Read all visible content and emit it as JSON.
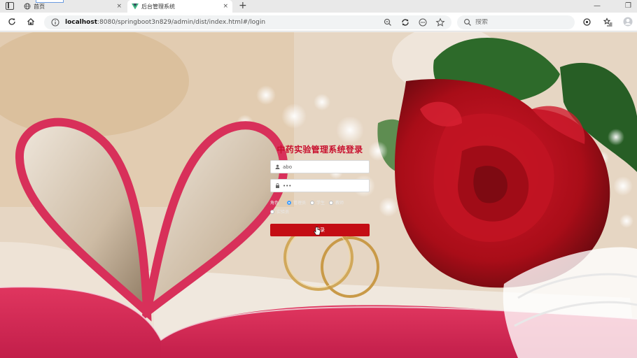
{
  "browser": {
    "tabs": [
      {
        "label": "首页",
        "close": "×"
      },
      {
        "label": "后台管理系统",
        "close": "×"
      }
    ],
    "new_tab": "+",
    "window_controls": {
      "minimize": "—",
      "restore": "❐"
    },
    "url_host": "localhost",
    "url_rest": ":8080/springboot3n829/admin/dist/index.html#/login",
    "search_placeholder": "搜索"
  },
  "login": {
    "title": "中药实验管理系统登录",
    "username_value": "abo",
    "password_value": "•••",
    "role_label": "角色",
    "roles": [
      {
        "label": "管理员",
        "checked": true
      },
      {
        "label": "学生",
        "checked": false
      },
      {
        "label": "教师",
        "checked": false
      },
      {
        "label": "实验员",
        "checked": false
      }
    ],
    "submit_label": "登录"
  },
  "colors": {
    "title": "#c8102e",
    "button": "#c40d14",
    "radio_checked": "#409eff",
    "book_pink": "#d8305a",
    "rose_red": "#b50f1a",
    "leaf_green": "#2f6b2a"
  },
  "icons": [
    "info-icon",
    "reload-icon",
    "home-icon",
    "search-icon",
    "user-icon",
    "lock-icon",
    "star-icon",
    "cursor-icon"
  ]
}
